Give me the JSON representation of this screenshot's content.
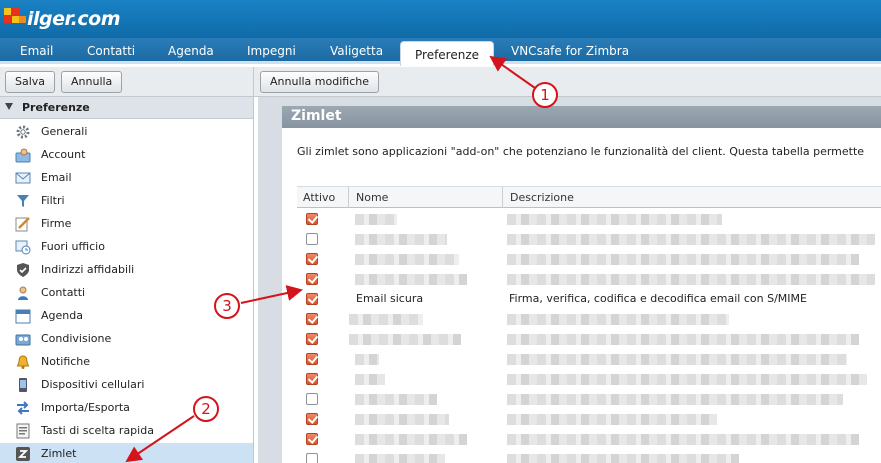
{
  "app": {
    "logo_text": "ilger.com"
  },
  "tabs": [
    {
      "label": "Email"
    },
    {
      "label": "Contatti"
    },
    {
      "label": "Agenda"
    },
    {
      "label": "Impegni"
    },
    {
      "label": "Valigetta"
    },
    {
      "label": "Preferenze",
      "active": true
    },
    {
      "label": "VNCsafe for Zimbra"
    }
  ],
  "toolbar": {
    "save_label": "Salva",
    "cancel_label": "Annulla",
    "undo_changes_label": "Annulla modifiche"
  },
  "sidebar": {
    "header": "Preferenze",
    "items": [
      {
        "label": "Generali",
        "icon": "gear-icon"
      },
      {
        "label": "Account",
        "icon": "account-icon"
      },
      {
        "label": "Email",
        "icon": "envelope-icon"
      },
      {
        "label": "Filtri",
        "icon": "filter-icon"
      },
      {
        "label": "Firme",
        "icon": "signature-icon"
      },
      {
        "label": "Fuori ufficio",
        "icon": "out-of-office-icon"
      },
      {
        "label": "Indirizzi affidabili",
        "icon": "shield-icon"
      },
      {
        "label": "Contatti",
        "icon": "contact-icon"
      },
      {
        "label": "Agenda",
        "icon": "calendar-icon"
      },
      {
        "label": "Condivisione",
        "icon": "sharing-icon"
      },
      {
        "label": "Notifiche",
        "icon": "bell-icon"
      },
      {
        "label": "Dispositivi cellulari",
        "icon": "mobile-icon"
      },
      {
        "label": "Importa/Esporta",
        "icon": "import-export-icon"
      },
      {
        "label": "Tasti di scelta rapida",
        "icon": "keyboard-icon"
      },
      {
        "label": "Zimlet",
        "icon": "zimlet-icon",
        "active": true
      }
    ]
  },
  "main": {
    "title": "Zimlet",
    "description": "Gli zimlet sono applicazioni \"add-on\" che potenziano le funzionalità del client. Questa tabella permette",
    "columns": {
      "active": "Attivo",
      "name": "Nome",
      "description": "Descrizione"
    },
    "rows": [
      {
        "checked": true
      },
      {
        "checked": false
      },
      {
        "checked": true
      },
      {
        "checked": true
      },
      {
        "checked": true,
        "name": "Email sicura",
        "description": "Firma, verifica, codifica e decodifica email con S/MIME"
      },
      {
        "checked": true
      },
      {
        "checked": true
      },
      {
        "checked": true
      },
      {
        "checked": true
      },
      {
        "checked": false
      },
      {
        "checked": true
      },
      {
        "checked": true
      },
      {
        "checked": false
      }
    ]
  },
  "callouts": [
    "1",
    "2",
    "3"
  ],
  "colors": {
    "accent": "#1a82c4",
    "selected": "#cde1f4",
    "callout": "#d4141c",
    "checkbox_on": "#d9532c"
  }
}
